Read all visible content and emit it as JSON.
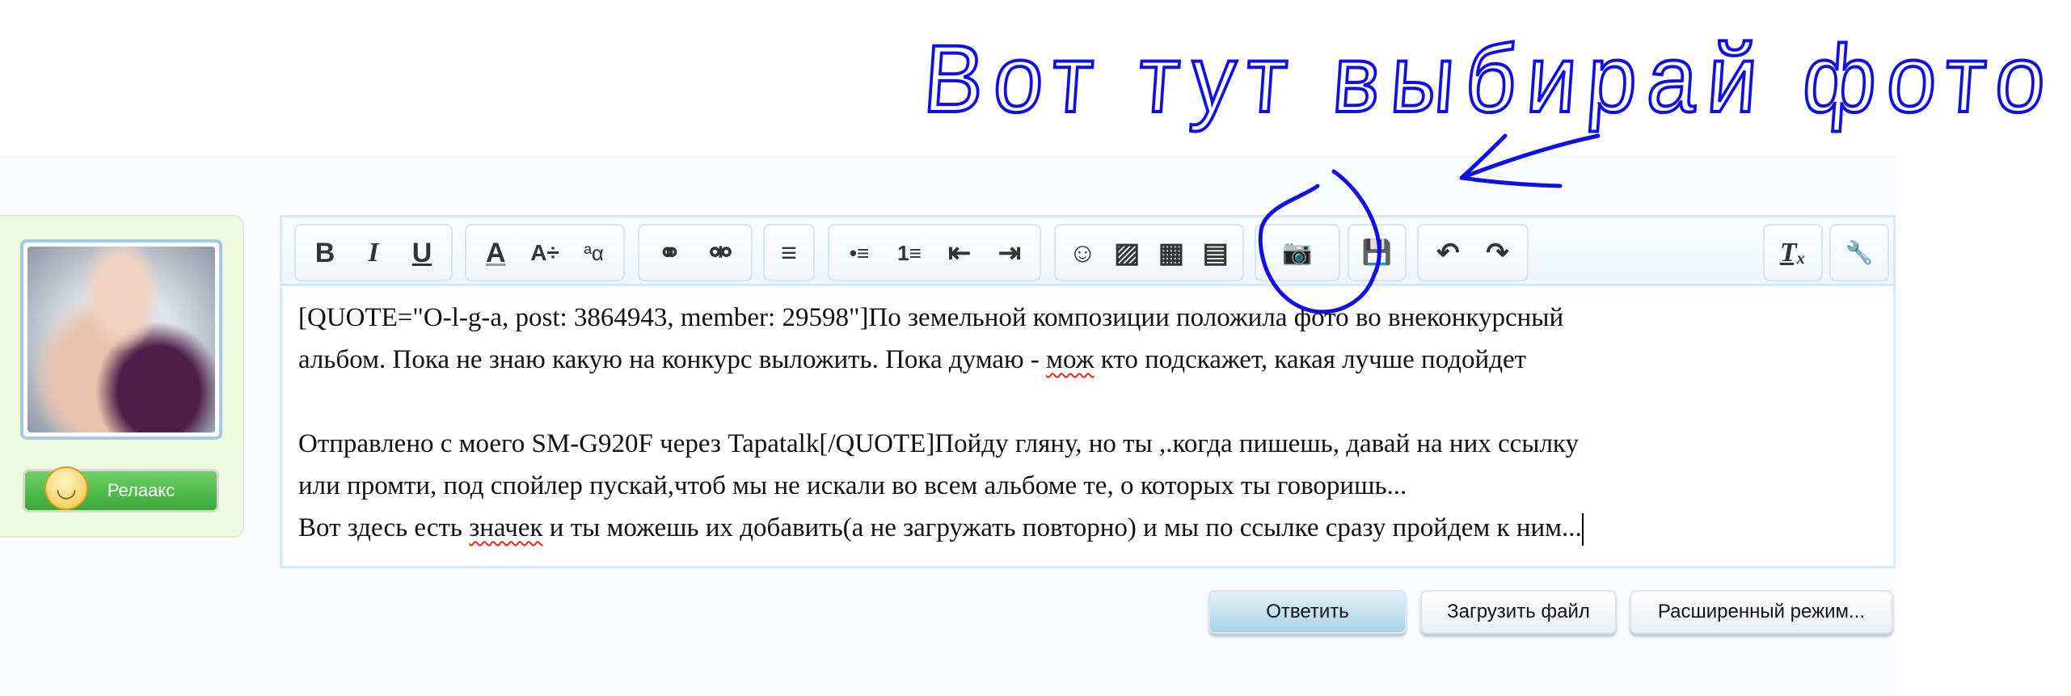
{
  "annotation": {
    "handwritten_text": "Вот тут выбирай фото",
    "color": "#1010e0"
  },
  "user": {
    "mood_label": "Релаакс",
    "avatar_alt": "avatar"
  },
  "toolbar": {
    "bold": "B",
    "italic": "I",
    "underline": "U",
    "font_color": "A",
    "font_size": "A÷",
    "font_family": "ªα",
    "link": "⚭",
    "unlink": "⚮",
    "align": "≡",
    "bullets": "•≡",
    "numbers": "1≡",
    "outdent": "⇤",
    "indent": "⇥",
    "smilies": "☺",
    "image": "▨",
    "media": "▦",
    "template": "▤",
    "photo": "📷",
    "save": "💾",
    "undo": "↶",
    "redo": "↷",
    "remove_format": "Tₓ",
    "tools": "🔧"
  },
  "message": {
    "lines": [
      "[QUOTE=\"O-l-g-a, post: 3864943, member: 29598\"]По земельной композиции положила фото во внеконкурсный",
      "альбом. Пока не знаю какую на конкурс выложить. Пока думаю - ",
      "мож",
      " кто подскажет, какая лучше подойдет",
      "",
      "Отправлено с моего SM-G920F через Tapatalk[/QUOTE]Пойду гляну, но ты ,.когда пишешь, давай на них ссылку",
      "или промти, под спойлер пускай,чтоб мы не искали во всем альбоме те, о которых ты говоришь...",
      "Вот здесь есть ",
      "значек",
      " и ты можешь их добавить(а не загружать повторно) и мы по ссылке сразу пройдем к ним..."
    ]
  },
  "buttons": {
    "reply": "Ответить",
    "upload": "Загрузить файл",
    "advanced": "Расширенный режим..."
  }
}
